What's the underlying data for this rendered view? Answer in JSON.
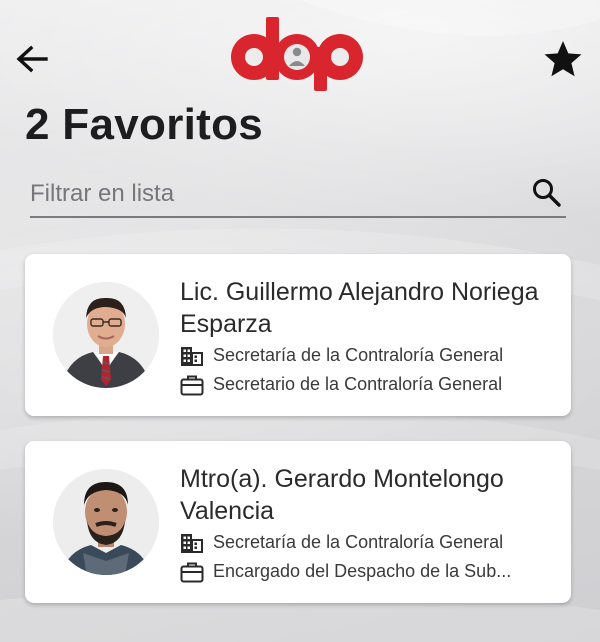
{
  "header": {
    "back_icon": "arrow-left-icon",
    "logo_text": "dap",
    "favorite_icon": "star-icon",
    "brand_color": "#d9262e"
  },
  "page": {
    "title": "2 Favoritos"
  },
  "search": {
    "placeholder": "Filtrar en lista",
    "value": "",
    "icon": "search-icon"
  },
  "favorites": [
    {
      "name": "Lic. Guillermo Alejandro Noriega Esparza",
      "office": "Secretaría de la Contraloría General",
      "position": "Secretario de la Contraloría General",
      "office_icon": "building-icon",
      "position_icon": "briefcase-icon"
    },
    {
      "name": "Mtro(a). Gerardo Montelongo Valencia",
      "office": "Secretaría de la Contraloría General",
      "position": "Encargado del Despacho de la Sub...",
      "office_icon": "building-icon",
      "position_icon": "briefcase-icon"
    }
  ]
}
